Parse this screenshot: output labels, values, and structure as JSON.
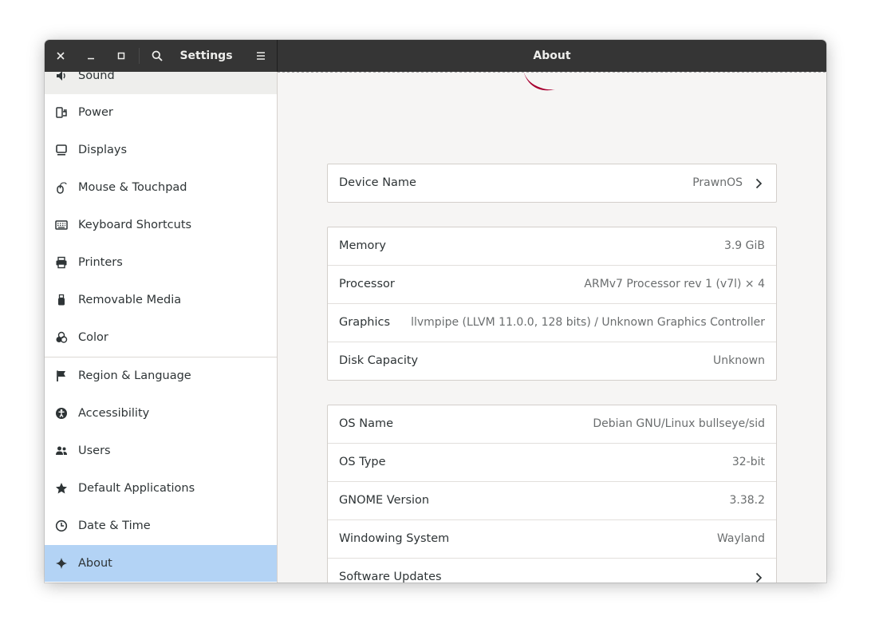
{
  "headerbar": {
    "sidebar_title": "Settings",
    "main_title": "About",
    "close_icon": "close-icon",
    "minimize_icon": "minimize-icon",
    "maximize_icon": "maximize-icon",
    "search_icon": "search-icon",
    "menu_icon": "menu-icon"
  },
  "sidebar": {
    "items": [
      {
        "label": "Sound",
        "icon": "speaker-icon"
      },
      {
        "label": "Power",
        "icon": "power-icon"
      },
      {
        "label": "Displays",
        "icon": "display-icon"
      },
      {
        "label": "Mouse & Touchpad",
        "icon": "mouse-icon"
      },
      {
        "label": "Keyboard Shortcuts",
        "icon": "keyboard-icon"
      },
      {
        "label": "Printers",
        "icon": "printer-icon"
      },
      {
        "label": "Removable Media",
        "icon": "usb-icon"
      },
      {
        "label": "Color",
        "icon": "color-icon"
      },
      {
        "label": "Region & Language",
        "icon": "flag-icon"
      },
      {
        "label": "Accessibility",
        "icon": "accessibility-icon"
      },
      {
        "label": "Users",
        "icon": "users-icon"
      },
      {
        "label": "Default Applications",
        "icon": "star-icon"
      },
      {
        "label": "Date & Time",
        "icon": "clock-icon"
      },
      {
        "label": "About",
        "icon": "sparkle-icon"
      }
    ],
    "selected": "About"
  },
  "about": {
    "device": {
      "label": "Device Name",
      "value": "PrawnOS"
    },
    "hardware": [
      {
        "label": "Memory",
        "value": "3.9 GiB"
      },
      {
        "label": "Processor",
        "value": "ARMv7 Processor rev 1 (v7l) × 4"
      },
      {
        "label": "Graphics",
        "value": "llvmpipe (LLVM 11.0.0, 128 bits) / Unknown Graphics Controller"
      },
      {
        "label": "Disk Capacity",
        "value": "Unknown"
      }
    ],
    "software": [
      {
        "label": "OS Name",
        "value": "Debian GNU/Linux bullseye/sid"
      },
      {
        "label": "OS Type",
        "value": "32-bit"
      },
      {
        "label": "GNOME Version",
        "value": "3.38.2"
      },
      {
        "label": "Windowing System",
        "value": "Wayland"
      }
    ],
    "updates": {
      "label": "Software Updates"
    }
  },
  "colors": {
    "headerbar": "#353535",
    "selected": "#b3d3f5",
    "logo": "#a80030"
  }
}
